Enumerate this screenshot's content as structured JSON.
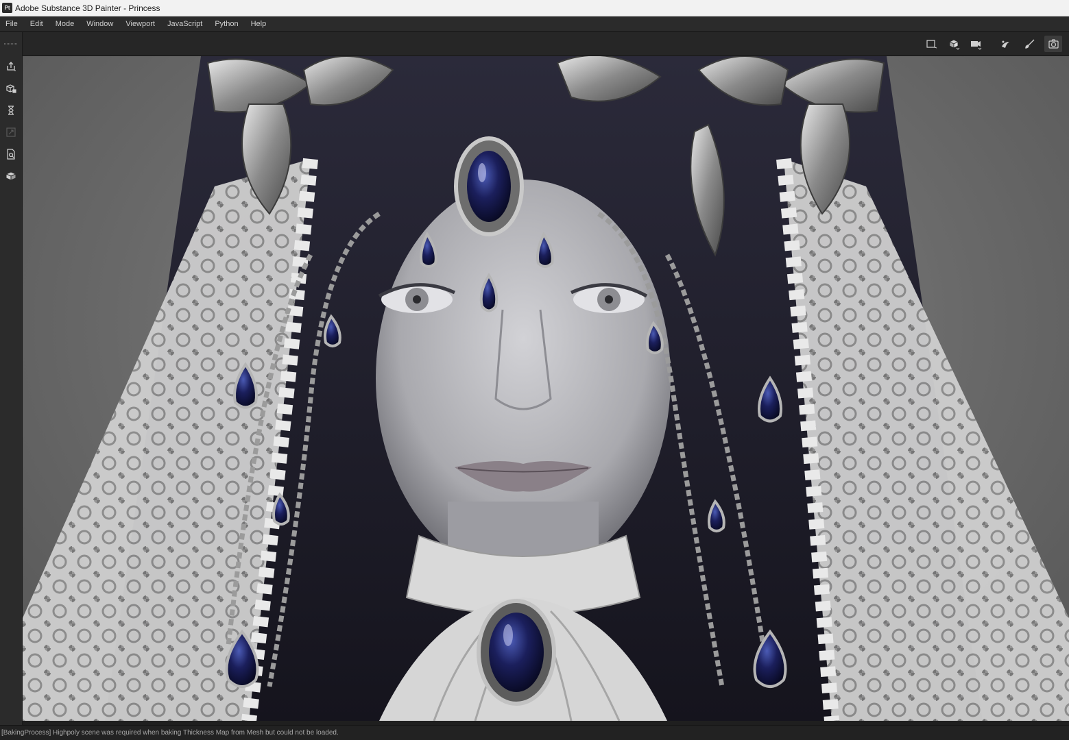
{
  "window": {
    "app_icon": "Pt",
    "title": "Adobe Substance 3D Painter - Princess"
  },
  "menubar": {
    "items": [
      "File",
      "Edit",
      "Mode",
      "Window",
      "Viewport",
      "JavaScript",
      "Python",
      "Help"
    ]
  },
  "left_toolbar": {
    "items": [
      {
        "icon": "export-icon",
        "has_dropdown": true
      },
      {
        "icon": "bake-mesh-icon",
        "has_dropdown": false
      },
      {
        "icon": "hourglass-icon",
        "has_dropdown": false
      },
      {
        "icon": "transform-icon",
        "has_dropdown": false,
        "disabled": true
      },
      {
        "icon": "document-search-icon",
        "has_dropdown": false
      },
      {
        "icon": "mesh-box-icon",
        "has_dropdown": false
      }
    ]
  },
  "viewport_toolbar": {
    "items": [
      {
        "icon": "uv-view-icon",
        "has_dropdown": false
      },
      {
        "icon": "3d-cube-icon",
        "has_dropdown": true
      },
      {
        "icon": "camera-icon",
        "has_dropdown": true
      },
      {
        "icon": "iray-render-icon",
        "has_dropdown": false
      },
      {
        "icon": "paint-brush-icon",
        "has_dropdown": false
      },
      {
        "icon": "screenshot-icon",
        "has_dropdown": false,
        "active": true
      }
    ]
  },
  "viewport": {
    "content": "3d-render"
  },
  "statusbar": {
    "message": "[BakingProcess] Highpoly scene was required when baking Thickness Map from Mesh but could not be loaded."
  },
  "colors": {
    "gem": "#1b1f5c",
    "panel": "#2b2b2b",
    "titlebar": "#f2f2f2"
  }
}
